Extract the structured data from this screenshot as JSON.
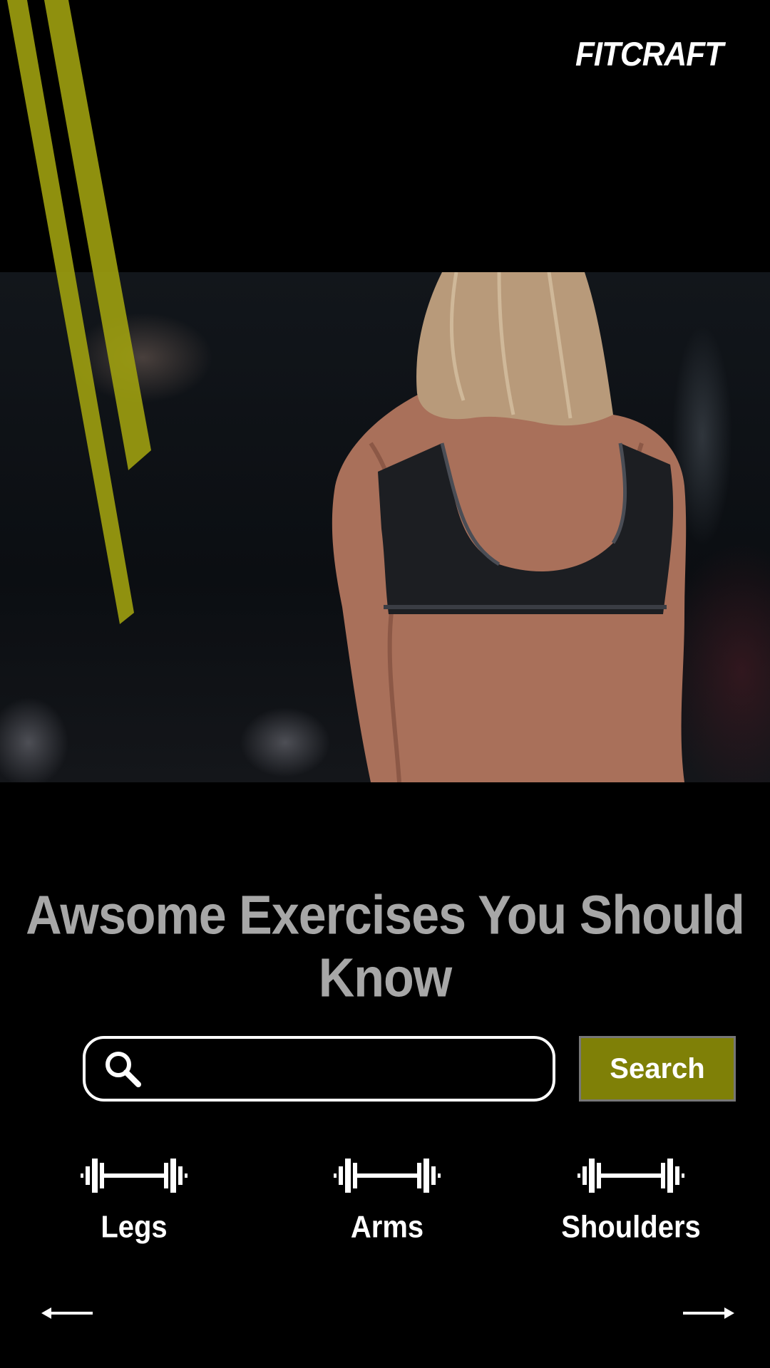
{
  "brand": {
    "logo_text": "FITCRAFT"
  },
  "hero": {
    "image": "woman-back-gym-photo"
  },
  "headline": "Awsome Exercises You Should Know",
  "search": {
    "placeholder": "",
    "value": "",
    "icon": "search-icon",
    "button_label": "Search"
  },
  "categories": [
    {
      "label": "Legs",
      "icon": "barbell-icon"
    },
    {
      "label": "Arms",
      "icon": "barbell-icon"
    },
    {
      "label": "Shoulders",
      "icon": "barbell-icon"
    }
  ],
  "nav": {
    "prev_icon": "arrow-left-icon",
    "next_icon": "arrow-right-icon"
  },
  "colors": {
    "accent": "#7f8007",
    "stripe": "#9fa00f",
    "headline": "#a7a7a7",
    "background": "#000000"
  }
}
